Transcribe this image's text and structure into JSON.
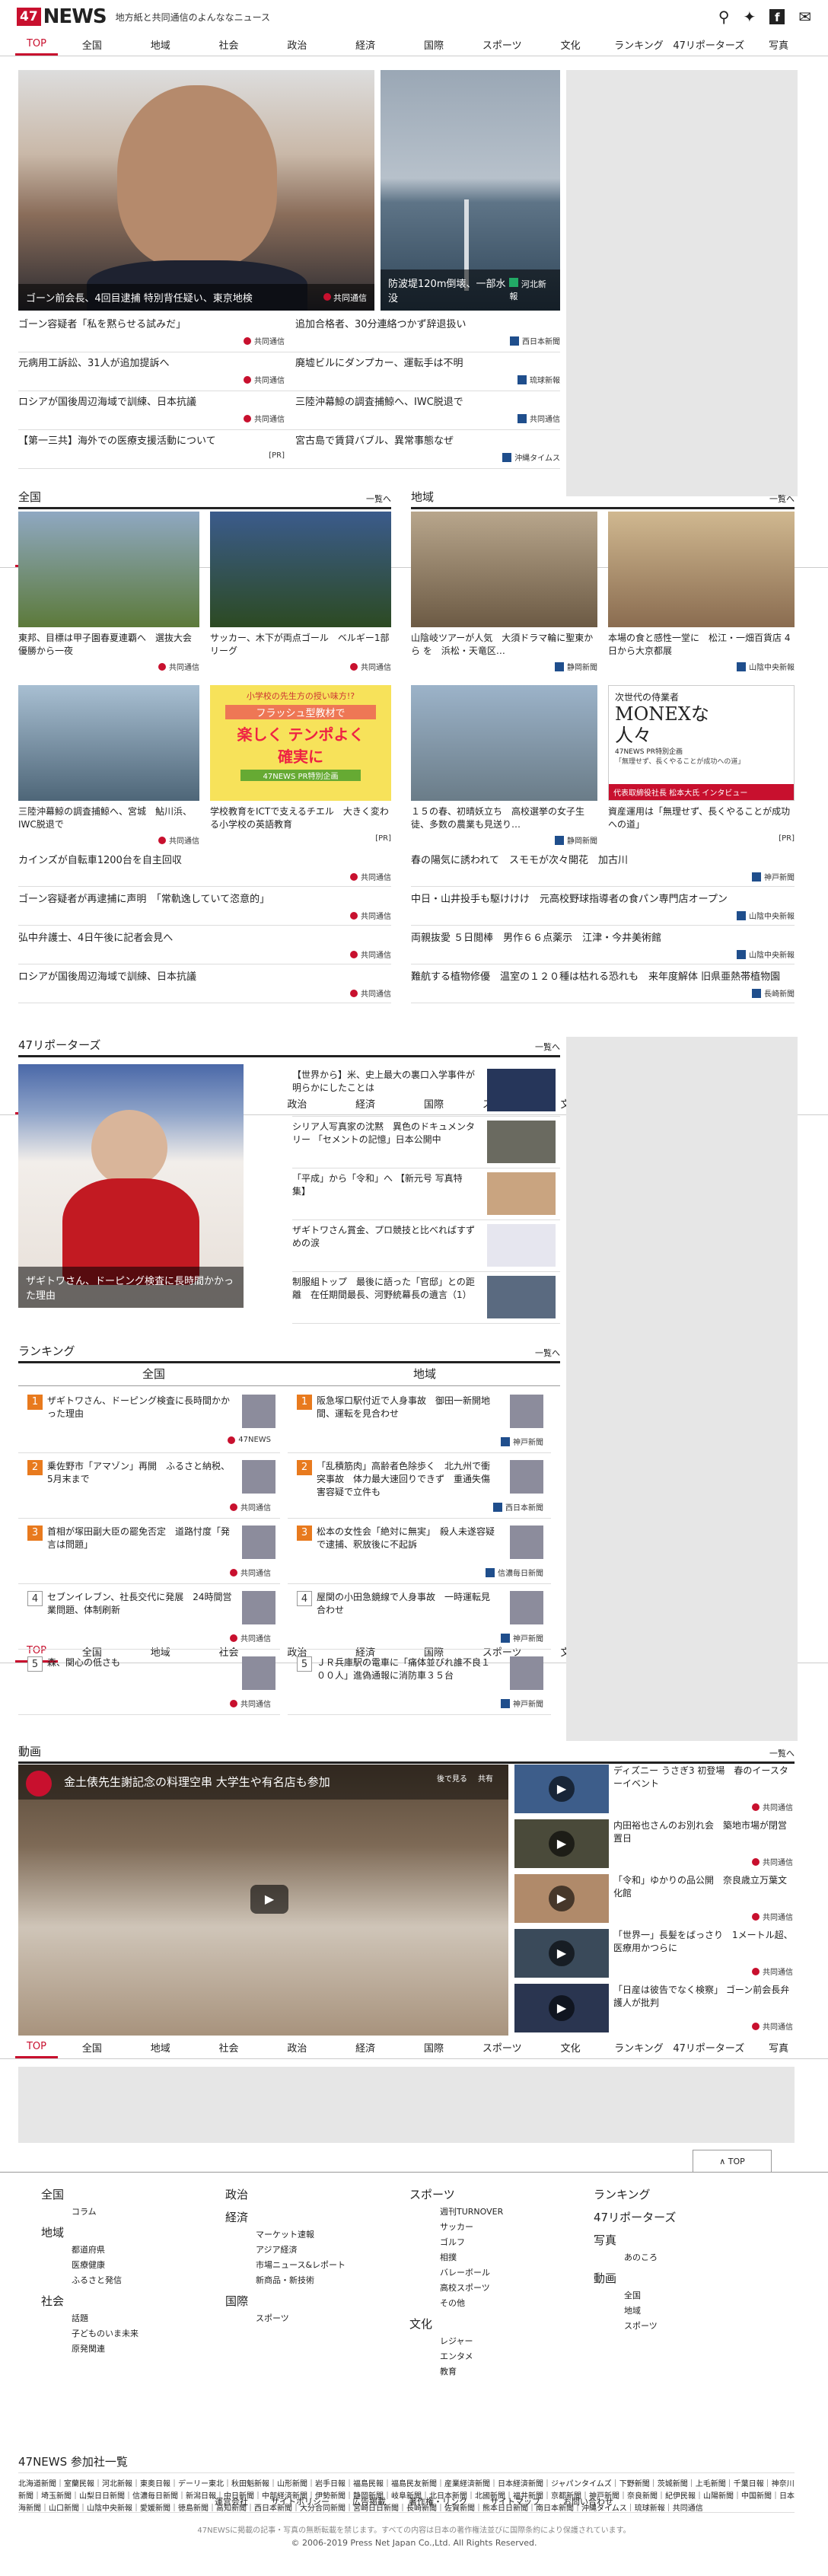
{
  "header": {
    "logo_num": "47",
    "logo_text": "NEWS",
    "tagline": "地方紙と共同通信のよんななニュース",
    "icons": [
      "search-icon",
      "twitter-icon",
      "facebook-icon",
      "mail-icon"
    ]
  },
  "nav": [
    "TOP",
    "全国",
    "地域",
    "社会",
    "政治",
    "経済",
    "国際",
    "スポーツ",
    "文化",
    "ランキング",
    "47リポーターズ",
    "写真"
  ],
  "hero": {
    "main_caption": "ゴーン前会長、4回目逮捕 特別背任疑い、東京地検",
    "main_src": "共同通信",
    "side_caption": "防波堤120m倒壊、一部水没",
    "side_src": "河北新報"
  },
  "top_list": [
    {
      "l": "ゴーン容疑者「私を黙らせる試みだ」",
      "ls": "共同通信",
      "r": "追加合格者、30分連絡つかず辞退扱い",
      "rs": "西日本新聞"
    },
    {
      "l": "元病用工訴訟、31人が追加提訴へ",
      "ls": "共同通信",
      "r": "廃墟ビルにダンプカー、運転手は不明",
      "rs": "琉球新報"
    },
    {
      "l": "ロシアが国後周辺海域で訓練、日本抗議",
      "ls": "共同通信",
      "r": "三陸沖幕鯨の調査捕鯨へ、IWC脱退で",
      "rs": "共同通信"
    },
    {
      "l": "【第一三共】海外での医療支援活動について",
      "ls": "[PR]",
      "r": "宮古島で賃貸バブル、異常事態なぜ",
      "rs": "沖縄タイムス"
    }
  ],
  "zenkoku": {
    "title": "全国",
    "more": "一覧へ",
    "cards": [
      {
        "t": "東邦、目標は甲子園春夏連覇へ　選抜大会優勝から一夜",
        "s": "共同通信"
      },
      {
        "t": "サッカー、木下が両点ゴール　ベルギー1部リーグ",
        "s": "共同通信"
      },
      {
        "t": "三陸沖幕鯨の調査捕鯨へ、宮城　鮎川浜、IWC脱退で",
        "s": "共同通信"
      },
      {
        "t": "学校教育をICTで支えるチエル　大きく変わる小学校の英語教育",
        "s": "[PR]"
      }
    ],
    "list": [
      {
        "t": "カインズが自転車1200台を自主回収",
        "s": "共同通信"
      },
      {
        "t": "ゴーン容疑者が再逮捕に声明　「常軌逸していて恣意的」",
        "s": "共同通信"
      },
      {
        "t": "弘中弁護士、4日午後に記者会見へ",
        "s": "共同通信"
      },
      {
        "t": "ロシアが国後周辺海域で訓練、日本抗議",
        "s": "共同通信"
      }
    ]
  },
  "chiiki": {
    "title": "地域",
    "more": "一覧へ",
    "cards": [
      {
        "t": "山陰岐ツアーが人気　大須ドラマ輪に聖東から を　浜松・天竜区…",
        "s": "静岡新聞"
      },
      {
        "t": "本場の食と感性一堂に　松江・一畑百貨店 4日から大京都展",
        "s": "山陰中央新報"
      },
      {
        "t": "１５の春、初晴妖立ち　高校選挙の女子生徒、多数の農業も見送り…",
        "s": "静岡新聞"
      },
      {
        "t": "資産運用は「無理せず、長くやることが成功への道」",
        "s": "[PR]"
      }
    ],
    "list": [
      {
        "t": "春の陽気に誘われて　スモモが次々開花　加古川",
        "s": "神戸新聞"
      },
      {
        "t": "中日・山井投手も駆けけけ　元高校野球指導者の食パン専門店オープン",
        "s": "山陰中央新報"
      },
      {
        "t": "両親抜愛 ５日閲棒　男作６６点薬示　江津・今井美術館",
        "s": "山陰中央新報"
      },
      {
        "t": "難航する植物修優　温室の１２０種は枯れる恐れも　来年度解体 旧県亜熱帯植物園",
        "s": "長崎新聞"
      }
    ]
  },
  "ad_monex": {
    "small": "次世代の侍業者",
    "big1": "MONEXな",
    "big2": "人々",
    "brand": "47NEWS PR特別企画",
    "quote": "「無理せず、長くやることが成功への道」",
    "footer": "代表取締役社長 松本大氏 インタビュー"
  },
  "ad_flash": {
    "top": "小学校の先生方の授い味方!?",
    "mid": "フラッシュ型教材で",
    "big1": "楽しく テンポよく",
    "big2": "確実に",
    "bottom": "47NEWS PR特別企画"
  },
  "reporters": {
    "title": "47リポーターズ",
    "more": "一覧へ",
    "main_caption": "ザギトワさん、ドーピング検査に長時間かかった理由",
    "items": [
      "【世界から】米、史上最大の裏口入学事件が明らかにしたことは",
      "シリア人写真家の沈黙　異色のドキュメンタリー 「セメントの記憶」日本公開中",
      "「平成」から「令和」へ 【新元号 写真特集】",
      "ザギトワさん賞金、プロ競技と比べればすずめの涙",
      "制服組トップ　最後に語った「官邸」との距離　在任期間最長、河野統幕長の遺言（1）"
    ]
  },
  "ranking": {
    "title": "ランキング",
    "more": "一覧へ",
    "col_l": "全国",
    "col_r": "地域",
    "left": [
      {
        "n": "1",
        "t": "ザギトワさん、ドーピング検査に長時間かかった理由",
        "s": "47NEWS"
      },
      {
        "n": "2",
        "t": "乗佐野市「アマゾン」再開　ふるさと納税、5月末まで",
        "s": "共同通信"
      },
      {
        "n": "3",
        "t": "首相が塚田副大臣の罷免否定　道路忖度「発言は問題」",
        "s": "共同通信"
      },
      {
        "n": "4",
        "t": "セブンイレブン、社長交代に発展　24時間営業問題、体制刷新",
        "s": "共同通信"
      },
      {
        "n": "5",
        "t": "森、関心の低さも",
        "s": "共同通信"
      }
    ],
    "right": [
      {
        "n": "1",
        "t": "阪急塚口駅付近で人身事故　御田一新開地間、運転を見合わせ",
        "s": "神戸新聞"
      },
      {
        "n": "2",
        "t": "「乱積筋肉」高齢者色除歩く　北九州で衝突事故　体力最大速回りできず　重通失傷害容疑で立件も",
        "s": "西日本新聞"
      },
      {
        "n": "3",
        "t": "松本の女性会「絶対に無実」　殺人未遂容疑で逮捕、釈放後に不起訴",
        "s": "信濃毎日新聞"
      },
      {
        "n": "4",
        "t": "屋関の小田急鏡線で人身事故　一時運転見合わせ",
        "s": "神戸新聞"
      },
      {
        "n": "5",
        "t": "ＪＲ兵庫駅の電車に「痛体並びれ誰不良１００人」進偽通報に消防車３５台",
        "s": "神戸新聞"
      }
    ]
  },
  "douga": {
    "title": "動画",
    "more": "一覧へ",
    "main_caption": "金土俵先生謝記念の料理空串 大学生や有名店も参加",
    "main_tools": [
      "後で見る",
      "共有"
    ],
    "items": [
      {
        "t": "ディズニー うさぎ3 初登場　春のイースターイベント",
        "s": "共同通信"
      },
      {
        "t": "内田裕也さんのお別れ会　築地市場が閉営置日",
        "s": "共同通信"
      },
      {
        "t": "「令和」ゆかりの品公開　奈良歳立万葉文化館",
        "s": "共同通信"
      },
      {
        "t": "「世界一」長髪をばっさり　1メートル超、医療用かつらに",
        "s": "共同通信"
      },
      {
        "t": "「日産は彼告でなく検察」 ゴーン前会長弁護人が批判",
        "s": "共同通信"
      }
    ]
  },
  "pagetop": "TOP",
  "footer": {
    "c1": [
      {
        "h": "全国"
      },
      {
        "s": "コラム"
      },
      {
        "h": "地域"
      },
      {
        "s": "都道府県"
      },
      {
        "s": "医療健康"
      },
      {
        "s": "ふるさと発信"
      },
      {
        "h": "社会"
      },
      {
        "s": "話題"
      },
      {
        "s": "子どものいま未来"
      },
      {
        "s": "原発関連"
      }
    ],
    "c2": [
      {
        "h": "政治"
      },
      {
        "h": "経済"
      },
      {
        "s": "マーケット速報"
      },
      {
        "s": "アジア経済"
      },
      {
        "s": "市場ニュース&レポート"
      },
      {
        "s": "新商品・新技術"
      },
      {
        "h": "国際"
      },
      {
        "s": "スポーツ"
      }
    ],
    "c3": [
      {
        "h": "スポーツ"
      },
      {
        "s": "週刊TURNOVER"
      },
      {
        "s": "サッカー"
      },
      {
        "s": "ゴルフ"
      },
      {
        "s": "相撲"
      },
      {
        "s": "バレーボール"
      },
      {
        "s": "高校スポーツ"
      },
      {
        "s": "その他"
      },
      {
        "h": "文化"
      },
      {
        "s": "レジャー"
      },
      {
        "s": "エンタメ"
      },
      {
        "s": "教育"
      }
    ],
    "c4": [
      {
        "h": "ランキング"
      },
      {
        "h": "47リポーターズ"
      },
      {
        "h": "写真"
      },
      {
        "s": "あのころ"
      },
      {
        "h": "動画"
      },
      {
        "s": "全国"
      },
      {
        "s": "地域"
      },
      {
        "s": "スポーツ"
      }
    ],
    "partners_title": "47NEWS 参加社一覧",
    "partners": "北海道新聞｜室蘭民報｜河北新報｜東奥日報｜デーリー東北｜秋田魁新報｜山形新聞｜岩手日報｜福島民報｜福島民友新聞｜産業経済新聞｜日本経済新聞｜ジャパンタイムズ｜下野新聞｜茨城新聞｜上毛新聞｜千葉日報｜神奈川新聞｜埼玉新聞｜山梨日日新聞｜信濃毎日新聞｜新潟日報｜中日新聞｜中部経済新聞｜伊勢新聞｜静岡新聞｜岐阜新聞｜北日本新聞｜北國新聞｜福井新聞｜京都新聞｜神戸新聞｜奈良新聞｜紀伊民報｜山陽新聞｜中国新聞｜日本海新聞｜山口新聞｜山陰中央新報｜愛媛新聞｜徳島新聞｜高知新聞｜西日本新聞｜大分合同新聞｜宮崎日日新聞｜長崎新聞｜佐賀新聞｜熊本日日新聞｜南日本新聞｜沖縄タイムス｜琉球新報｜共同通信",
    "links": [
      "運営会社",
      "サイトポリシー",
      "広告掲載",
      "著作権・リンク",
      "サイトマップ",
      "お問い合わせ"
    ],
    "notice": "47NEWSに掲載の記事・写真の無断転載を禁じます。すべての内容は日本の著作権法並びに国際条約により保護されています。",
    "copyright": "© 2006-2019 Press Net Japan Co.,Ltd. All Rights Reserved."
  }
}
